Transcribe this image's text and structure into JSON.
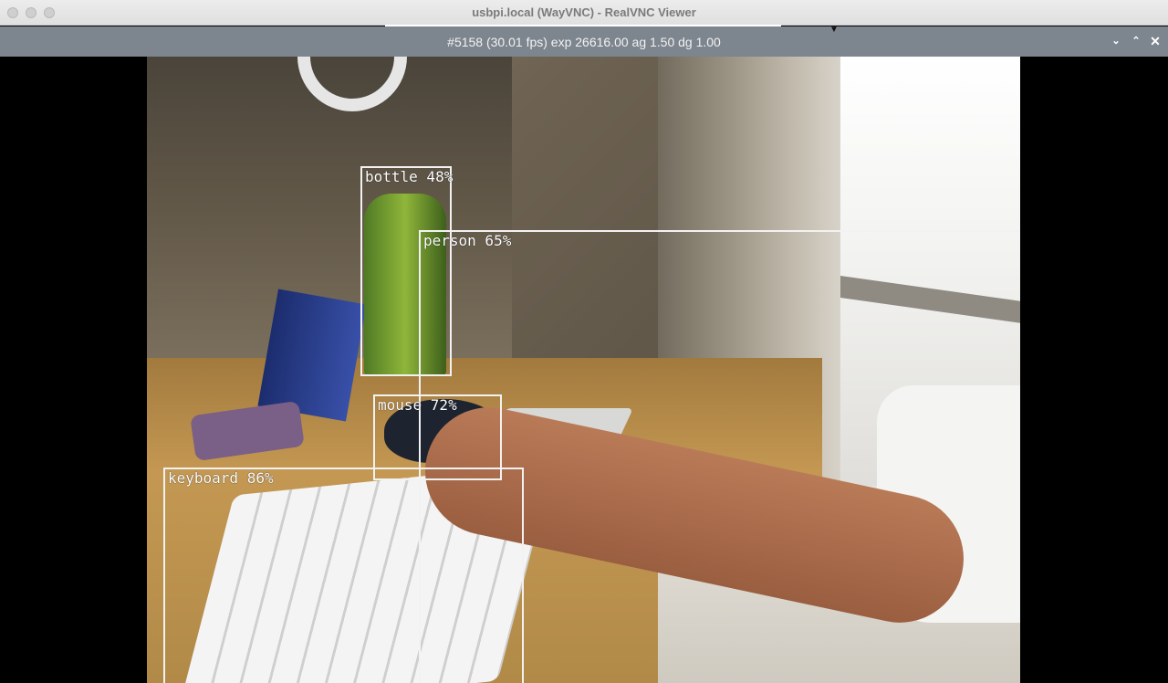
{
  "mac_window": {
    "title": "usbpi.local (WayVNC) - RealVNC Viewer"
  },
  "inner_window": {
    "title": "#5158 (30.01 fps) exp 26616.00 ag 1.50 dg 1.00",
    "controls": {
      "down_glyph": "⌄",
      "up_glyph": "⌃",
      "close_glyph": "✕"
    }
  },
  "detections": [
    {
      "label": "bottle 48%"
    },
    {
      "label": "person 65%"
    },
    {
      "label": "mouse 72%"
    },
    {
      "label": "keyboard 86%"
    }
  ],
  "colors": {
    "titlebar": "#e5e5e5",
    "inner_bar": "#7d858e",
    "box_stroke": "#f2f2f2"
  }
}
